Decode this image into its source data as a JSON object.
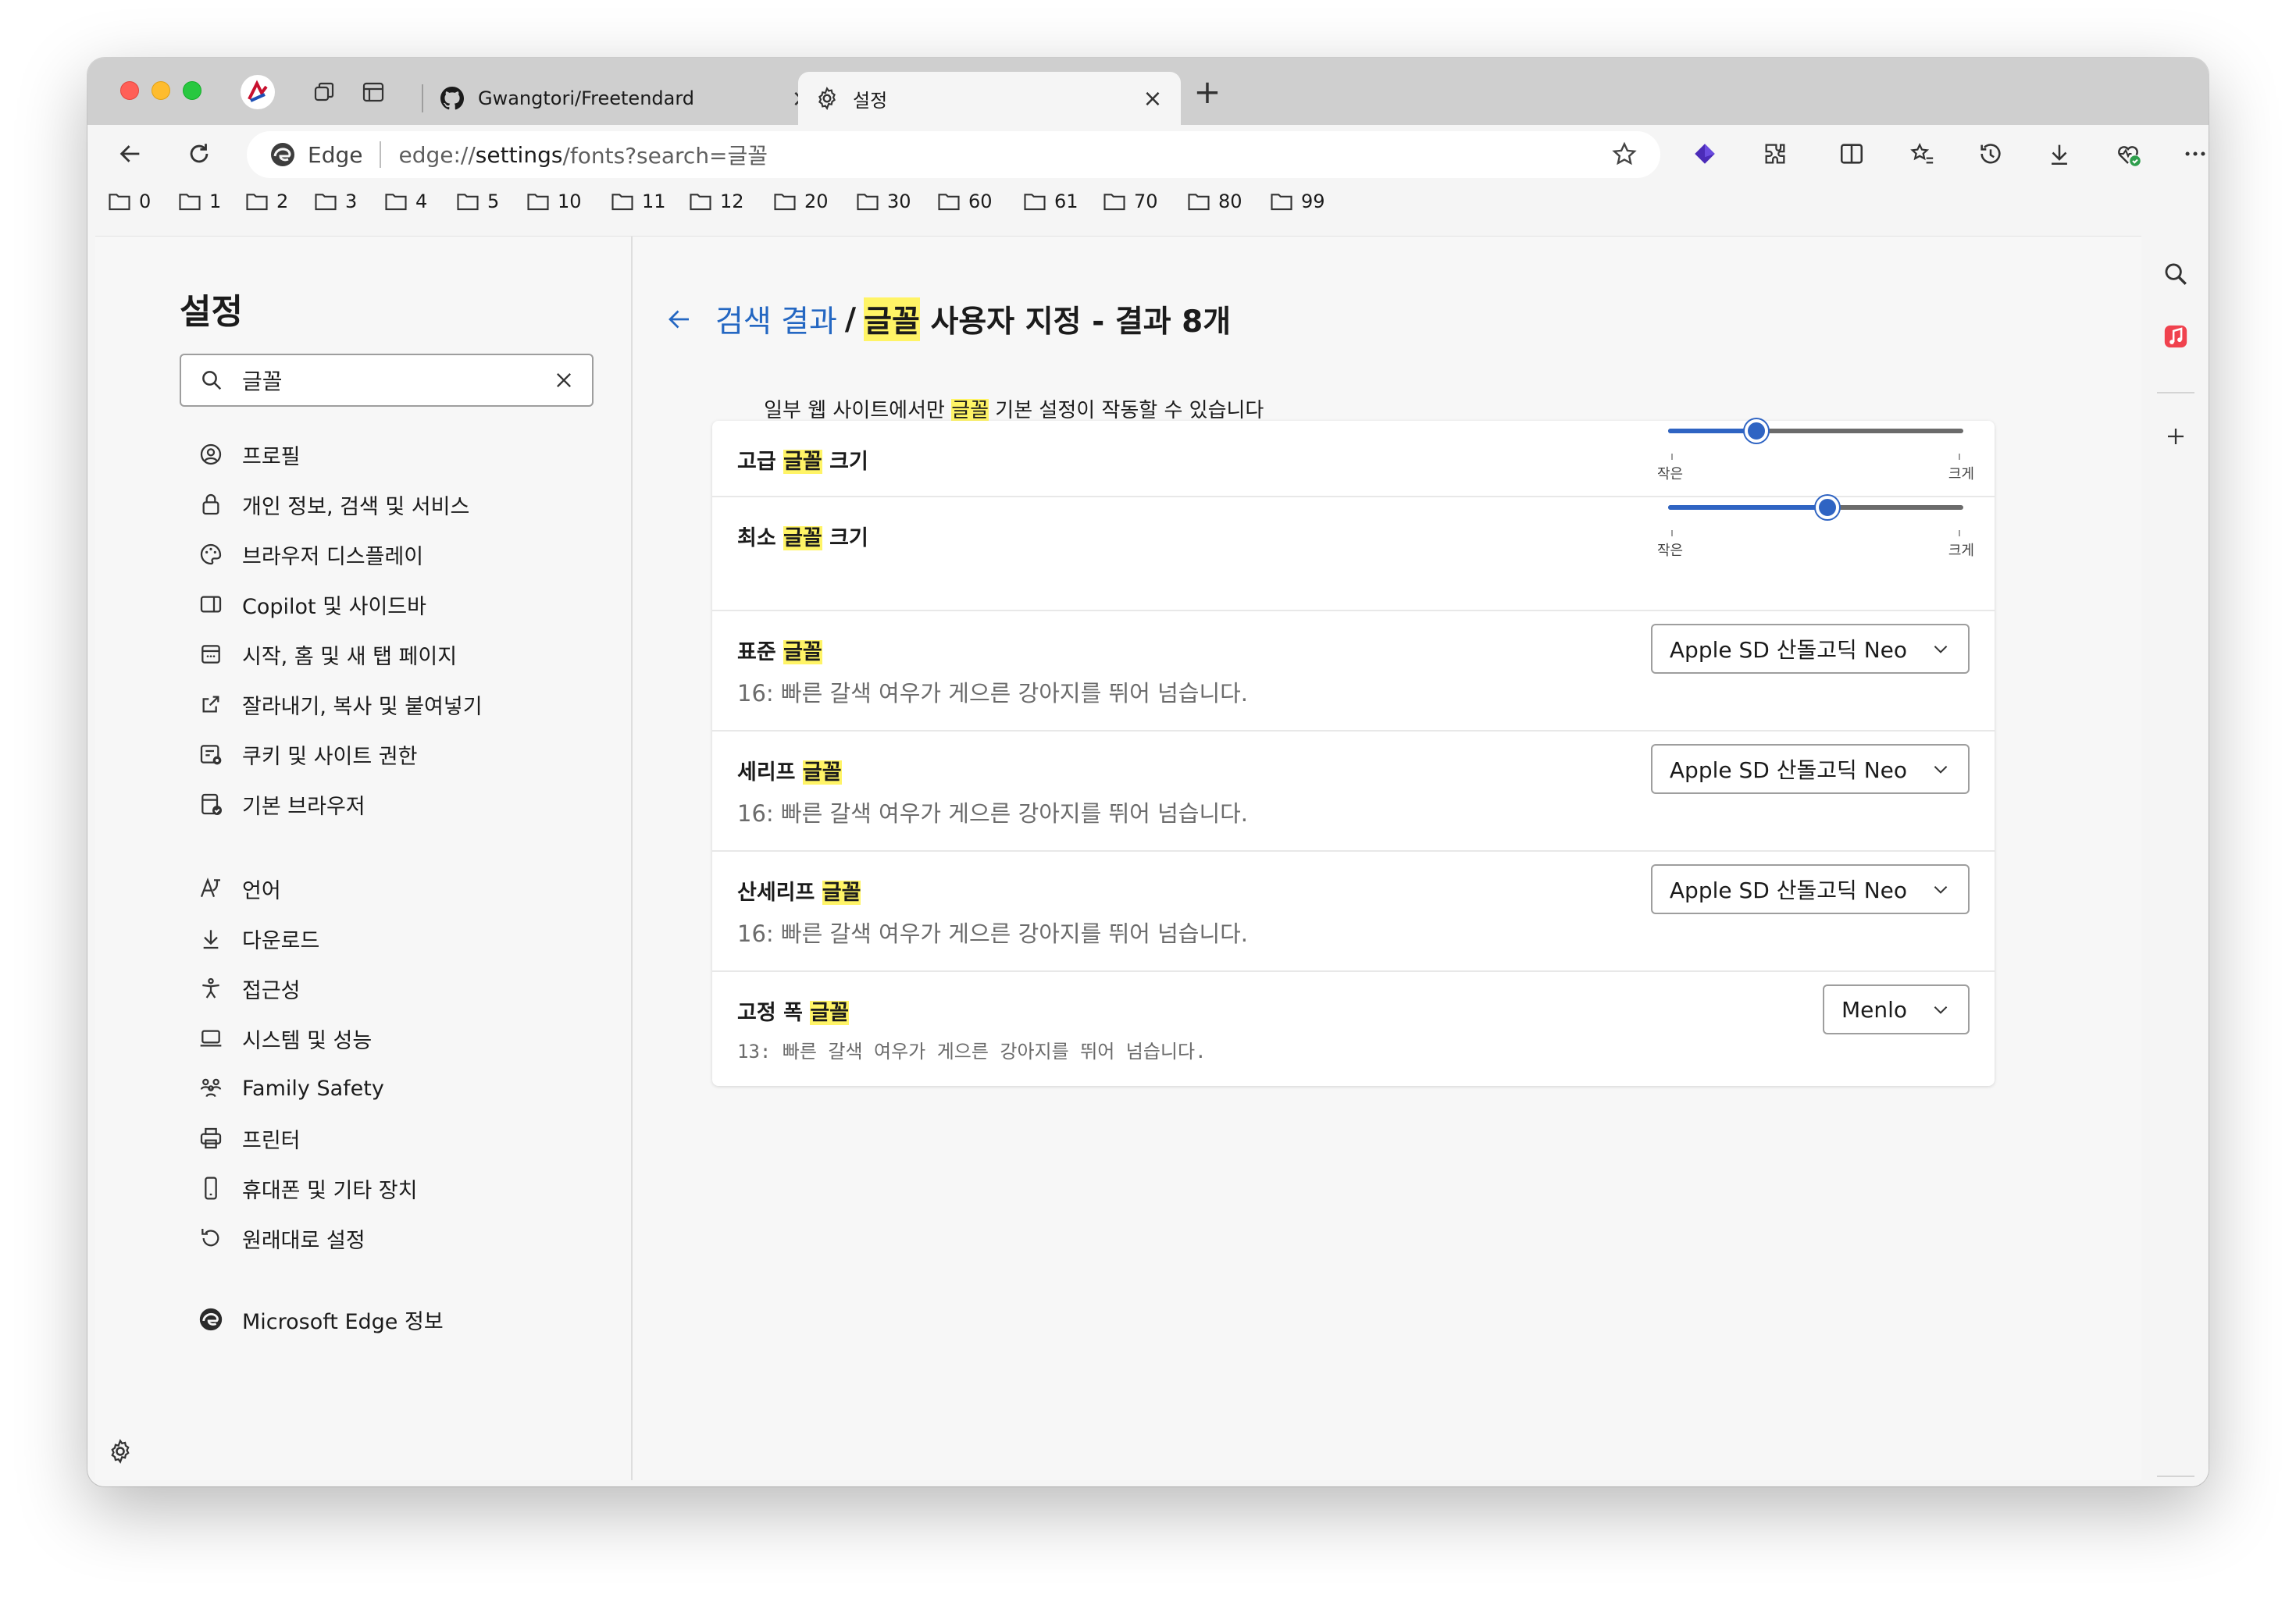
{
  "tabs": [
    {
      "title": "Gwangtori/Freetendard",
      "favicon": "github-icon"
    },
    {
      "title": "설정",
      "favicon": "gear-icon"
    }
  ],
  "address_bar": {
    "site_label": "Edge",
    "url_scheme": "edge://",
    "url_host": "settings",
    "url_path": "/fonts?search=글꼴"
  },
  "favorites": [
    "0",
    "1",
    "2",
    "3",
    "4",
    "5",
    "10",
    "11",
    "12",
    "20",
    "30",
    "60",
    "61",
    "70",
    "80",
    "99"
  ],
  "sidebar": {
    "title": "설정",
    "search_value": "글꼴",
    "items": [
      {
        "label": "프로필",
        "icon": "profile-icon"
      },
      {
        "label": "개인 정보, 검색 및 서비스",
        "icon": "lock-icon"
      },
      {
        "label": "브라우저 디스플레이",
        "icon": "palette-icon"
      },
      {
        "label": "Copilot 및 사이드바",
        "icon": "sidebar-icon"
      },
      {
        "label": "시작, 홈 및 새 탭 페이지",
        "icon": "start-page-icon"
      },
      {
        "label": "잘라내기, 복사 및 붙여넣기",
        "icon": "share-icon"
      },
      {
        "label": "쿠키 및 사이트 권한",
        "icon": "site-permissions-icon"
      },
      {
        "label": "기본 브라우저",
        "icon": "default-browser-icon"
      },
      {
        "label": "언어",
        "icon": "language-icon"
      },
      {
        "label": "다운로드",
        "icon": "download-icon"
      },
      {
        "label": "접근성",
        "icon": "accessibility-icon"
      },
      {
        "label": "시스템 및 성능",
        "icon": "laptop-icon"
      },
      {
        "label": "Family Safety",
        "icon": "family-icon"
      },
      {
        "label": "프린터",
        "icon": "printer-icon"
      },
      {
        "label": "휴대폰 및 기타 장치",
        "icon": "phone-icon"
      },
      {
        "label": "원래대로 설정",
        "icon": "reset-icon"
      },
      {
        "label": "Microsoft Edge 정보",
        "icon": "edge-logo-icon"
      }
    ]
  },
  "main": {
    "breadcrumb_link": "검색 결과",
    "breadcrumb_sep": "/",
    "heading_highlight": "글꼴",
    "heading_rest": " 사용자 지정 - 결과 8개",
    "subtitle_before": "일부 웹 사이트에서만 ",
    "subtitle_highlight": "글꼴",
    "subtitle_after": " 기본 설정이 작동할 수 있습니다",
    "font_size": {
      "label_before": "고급 ",
      "label_highlight": "글꼴",
      "label_after": " 크기",
      "level": 0.3,
      "min_label": "작은",
      "max_label": "크게"
    },
    "min_font_size": {
      "label_before": "최소 ",
      "label_highlight": "글꼴",
      "label_after": " 크기",
      "level": 0.54,
      "min_label": "작은",
      "max_label": "크게"
    },
    "fonts": [
      {
        "label_before": "표준 ",
        "label_highlight": "글꼴",
        "sample": "16: 빠른 갈색 여우가 게으른 강아지를 뛰어 넘습니다.",
        "value": "Apple SD 산돌고딕 Neo"
      },
      {
        "label_before": "세리프 ",
        "label_highlight": "글꼴",
        "sample": "16: 빠른 갈색 여우가 게으른 강아지를 뛰어 넘습니다.",
        "value": "Apple SD 산돌고딕 Neo"
      },
      {
        "label_before": "산세리프 ",
        "label_highlight": "글꼴",
        "sample": "16: 빠른 갈색 여우가 게으른 강아지를 뛰어 넘습니다.",
        "value": "Apple SD 산돌고딕 Neo"
      },
      {
        "label_before": "고정 폭 ",
        "label_highlight": "글꼴",
        "sample": "13: 빠른 갈색 여우가 게으른 강아지를 뛰어 넘습니다.",
        "value": "Menlo"
      }
    ]
  },
  "colors": {
    "accent": "#2f64c3",
    "link": "#2467c2",
    "highlight": "#fff466",
    "tab_strip": "#cfcfcf"
  }
}
